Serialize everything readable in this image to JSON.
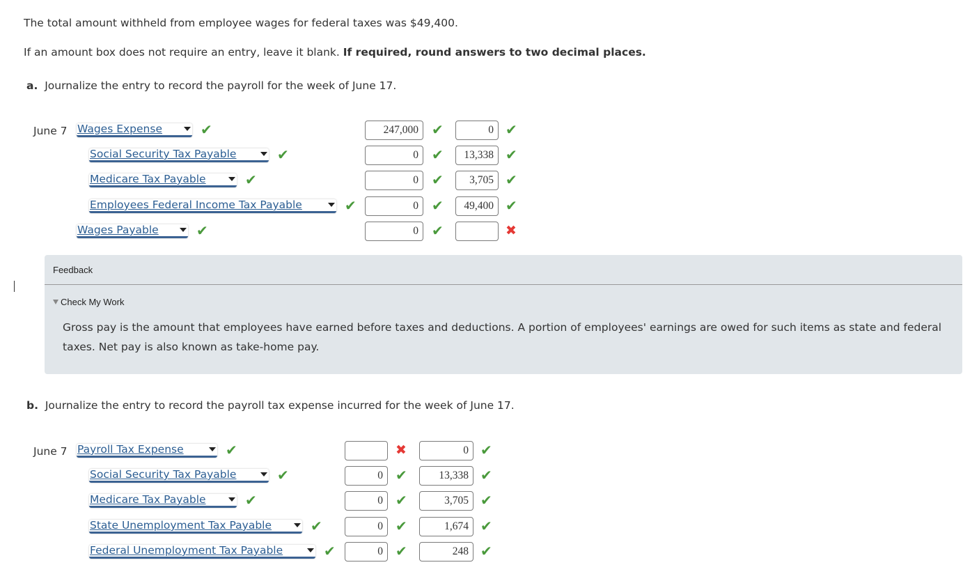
{
  "intro": {
    "line1": "The total amount withheld from employee wages for federal taxes was $49,400.",
    "line2_normal": "If an amount box does not require an entry, leave it blank. ",
    "line2_bold": "If required, round answers to two decimal places."
  },
  "part_a": {
    "label": "a.",
    "question": "Journalize the entry to record the payroll for the week of June 17.",
    "date": "June 7",
    "rows": [
      {
        "account": "Wages Expense",
        "account_status": "correct",
        "debit": "247,000",
        "debit_status": "correct",
        "credit": "0",
        "credit_status": "correct"
      },
      {
        "account": "Social Security Tax Payable",
        "account_status": "correct",
        "debit": "0",
        "debit_status": "correct",
        "credit": "13,338",
        "credit_status": "correct"
      },
      {
        "account": "Medicare Tax Payable",
        "account_status": "correct",
        "debit": "0",
        "debit_status": "correct",
        "credit": "3,705",
        "credit_status": "correct"
      },
      {
        "account": "Employees Federal Income Tax Payable",
        "account_status": "correct",
        "debit": "0",
        "debit_status": "correct",
        "credit": "49,400",
        "credit_status": "correct"
      },
      {
        "account": "Wages Payable",
        "account_status": "correct",
        "debit": "0",
        "debit_status": "correct",
        "credit": "",
        "credit_status": "incorrect"
      }
    ]
  },
  "feedback": {
    "title": "Feedback",
    "toggle_label": "Check My Work",
    "text": "Gross pay is the amount that employees have earned before taxes and deductions. A portion of employees' earnings are owed for such items as state and federal taxes. Net pay is also known as take-home pay."
  },
  "part_b": {
    "label": "b.",
    "question": "Journalize the entry to record the payroll tax expense incurred for the week of June 17.",
    "date": "June 7",
    "rows": [
      {
        "account": "Payroll Tax Expense",
        "account_status": "correct",
        "debit": "",
        "debit_status": "incorrect",
        "credit": "0",
        "credit_status": "correct"
      },
      {
        "account": "Social Security Tax Payable",
        "account_status": "correct",
        "debit": "0",
        "debit_status": "correct",
        "credit": "13,338",
        "credit_status": "correct"
      },
      {
        "account": "Medicare Tax Payable",
        "account_status": "correct",
        "debit": "0",
        "debit_status": "correct",
        "credit": "3,705",
        "credit_status": "correct"
      },
      {
        "account": "State Unemployment Tax Payable",
        "account_status": "correct",
        "debit": "0",
        "debit_status": "correct",
        "credit": "1,674",
        "credit_status": "correct"
      },
      {
        "account": "Federal Unemployment Tax Payable",
        "account_status": "correct",
        "debit": "0",
        "debit_status": "correct",
        "credit": "248",
        "credit_status": "correct"
      }
    ]
  },
  "icons": {
    "correct": "✔",
    "incorrect": "✖"
  },
  "colors": {
    "correct": "#4a9a3c",
    "incorrect": "#e53935",
    "link": "#2c5e93",
    "feedback_bg": "#e1e6ea"
  }
}
